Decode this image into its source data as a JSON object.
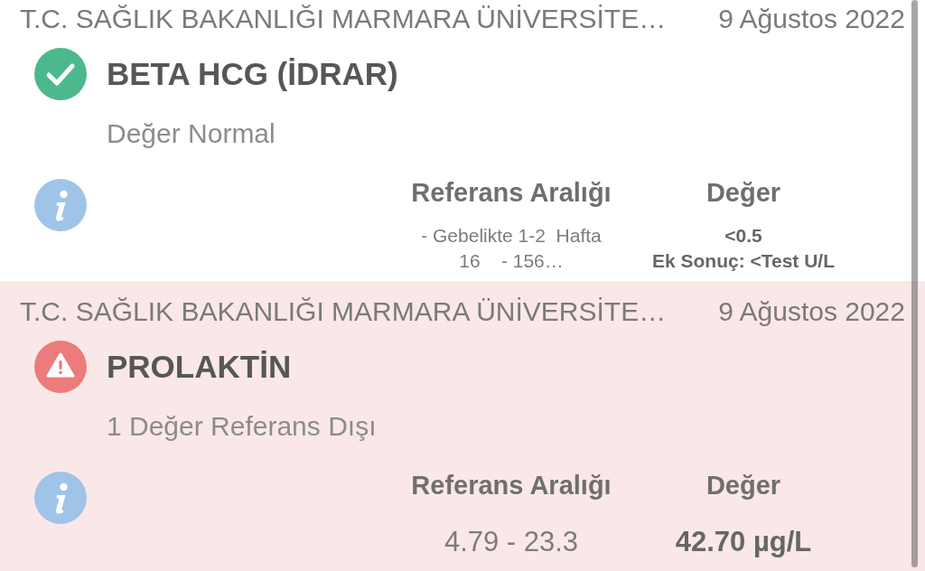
{
  "results": [
    {
      "kind": "normal",
      "institution": "T.C. SAĞLIK BAKANLIĞI MARMARA ÜNİVERSİTE…",
      "date": "9 Ağustos 2022",
      "title": "BETA HCG (İDRAR)",
      "summary": "Değer Normal",
      "columns": [
        "Referans Aralığı",
        "Değer"
      ],
      "reference": [
        "- Gebelikte 1-2  Hafta",
        "16    - 156…"
      ],
      "value": [
        "<0.5",
        "Ek Sonuç: <Test U/L"
      ]
    },
    {
      "kind": "abnormal",
      "institution": "T.C. SAĞLIK BAKANLIĞI MARMARA ÜNİVERSİTE…",
      "date": "9 Ağustos 2022",
      "title": "PROLAKTİN",
      "summary": "1 Değer Referans Dışı",
      "columns": [
        "Referans Aralığı",
        "Değer"
      ],
      "reference": [
        "4.79 - 23.3"
      ],
      "value": [
        "42.70 µg/L"
      ]
    }
  ]
}
